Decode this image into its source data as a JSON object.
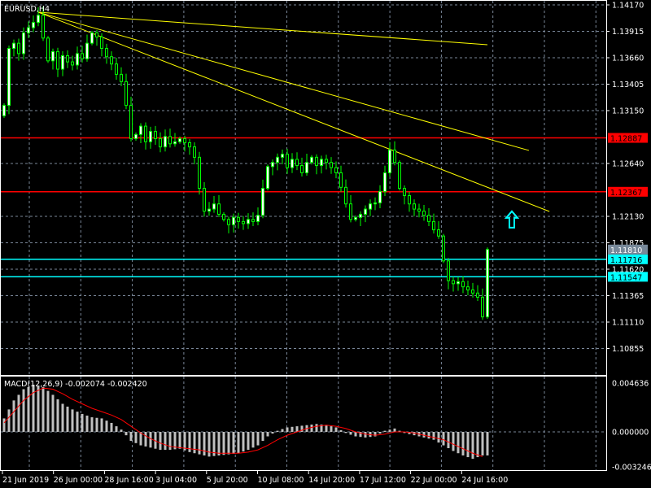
{
  "title": "EURUSD,H4",
  "colors": {
    "background": "#000000",
    "grid": "#7a8799",
    "candle_outline": "#00ff00",
    "bull_fill": "#ffffff",
    "bear_fill": "#000000",
    "trendline": "#ffff00",
    "support_resistance": "#ff0000",
    "cyan_level": "#00ffff",
    "bid_label": "#778899",
    "macd_hist": "#c0c0c0",
    "macd_signal": "#ff0000"
  },
  "chart_data": [
    {
      "type": "candlestick",
      "title": "EURUSD,H4",
      "symbol": "EURUSD",
      "timeframe": "H4",
      "ylim": [
        1.10855,
        1.1417
      ],
      "grid": true,
      "y_ticks": [
        "1.14170",
        "1.13915",
        "1.13660",
        "1.13405",
        "1.13150",
        "1.12640",
        "1.12130",
        "1.11875",
        "1.11620",
        "1.11365",
        "1.11110",
        "1.10855"
      ],
      "x_ticks": [
        "21 Jun 2019",
        "26 Jun 00:00",
        "28 Jun 16:00",
        "3 Jul 04:00",
        "5 Jul 20:00",
        "10 Jul 08:00",
        "14 Jul 20:00",
        "17 Jul 12:00",
        "22 Jul 00:00",
        "24 Jul 16:00"
      ],
      "closes": [
        1.132,
        1.1375,
        1.138,
        1.137,
        1.139,
        1.1395,
        1.14,
        1.1407,
        1.1385,
        1.1363,
        1.1372,
        1.1355,
        1.1368,
        1.1362,
        1.1359,
        1.137,
        1.1365,
        1.138,
        1.139,
        1.1386,
        1.1375,
        1.1367,
        1.136,
        1.135,
        1.1343,
        1.132,
        1.1288,
        1.1292,
        1.13,
        1.1285,
        1.1295,
        1.1288,
        1.128,
        1.129,
        1.1283,
        1.1285,
        1.1288,
        1.1284,
        1.128,
        1.127,
        1.124,
        1.1218,
        1.122,
        1.1225,
        1.1215,
        1.121,
        1.1205,
        1.1212,
        1.1208,
        1.1206,
        1.121,
        1.1208,
        1.1214,
        1.124,
        1.1261,
        1.1265,
        1.127,
        1.1273,
        1.126,
        1.1268,
        1.1262,
        1.1255,
        1.1265,
        1.127,
        1.1262,
        1.1268,
        1.1265,
        1.126,
        1.1255,
        1.1241,
        1.1225,
        1.121,
        1.1212,
        1.1215,
        1.122,
        1.1225,
        1.1226,
        1.1237,
        1.1255,
        1.1277,
        1.1265,
        1.124,
        1.1233,
        1.1225,
        1.122,
        1.1218,
        1.1214,
        1.1208,
        1.12,
        1.1194,
        1.117,
        1.1151,
        1.1148,
        1.115,
        1.1145,
        1.1142,
        1.1139,
        1.1135,
        1.1116,
        1.1181
      ],
      "trendlines": [
        {
          "from": [
            7,
            1.14099
          ],
          "to": [
            99,
            1.13786
          ]
        },
        {
          "from": [
            7,
            1.14099
          ],
          "to": [
            107.5,
            1.12766
          ]
        },
        {
          "from": [
            7,
            1.14099
          ],
          "to": [
            111.7,
            1.12177
          ]
        }
      ],
      "horizontal_levels": [
        {
          "price": "1.12887",
          "kind": "red"
        },
        {
          "price": "1.12367",
          "kind": "red"
        },
        {
          "price": "1.11716",
          "kind": "cyan"
        },
        {
          "price": "1.11547",
          "kind": "cyan"
        }
      ],
      "bid_price": "1.11810",
      "arrow": {
        "direction": "up",
        "at": [
          104,
          1.121
        ]
      }
    },
    {
      "type": "bar+line",
      "title": "MACD(12,26,9) -0.002074 -0.002420",
      "label": "MACD(12,26,9)",
      "main_value": "-0.002074",
      "signal_value": "-0.002420",
      "ylim": [
        -0.003246,
        0.004636
      ],
      "y_ticks": [
        "0.004636",
        "0.000000",
        "-0.003246"
      ],
      "macd": [
        0.0012,
        0.0028,
        0.0038,
        0.0042,
        0.004,
        0.0033,
        0.0025,
        0.002,
        0.0016,
        0.0013,
        0.0012,
        0.0008,
        0.0002,
        -0.0008,
        -0.0012,
        -0.0014,
        -0.0016,
        -0.0016,
        -0.0015,
        -0.0018,
        -0.002,
        -0.0022,
        -0.0021,
        -0.002,
        -0.0019,
        -0.0016,
        -0.0012,
        -0.0004,
        0.0001,
        0.0004,
        0.0005,
        0.0006,
        0.0007,
        0.0006,
        0.0004,
        -0.0001,
        -0.0004,
        -0.0005,
        -0.0004,
        0.0001,
        0.0003,
        -0.0001,
        -0.0003,
        -0.0005,
        -0.0007,
        -0.0012,
        -0.0017,
        -0.0021,
        -0.0024,
        -0.0021
      ],
      "signal": [
        0.0008,
        0.0018,
        0.0028,
        0.0035,
        0.0039,
        0.0038,
        0.0034,
        0.0029,
        0.0025,
        0.0021,
        0.0018,
        0.0015,
        0.0011,
        0.0005,
        -0.0001,
        -0.0006,
        -0.001,
        -0.0013,
        -0.0014,
        -0.0015,
        -0.0016,
        -0.0018,
        -0.0019,
        -0.0019,
        -0.0019,
        -0.0018,
        -0.0016,
        -0.0012,
        -0.0007,
        -0.0003,
        0.0,
        0.0003,
        0.0005,
        0.0006,
        0.0005,
        0.0003,
        0.0,
        -0.0002,
        -0.0003,
        -0.0002,
        0.0,
        0.0,
        -0.0001,
        -0.0003,
        -0.0005,
        -0.0007,
        -0.0011,
        -0.0015,
        -0.0019,
        -0.0022
      ]
    }
  ]
}
